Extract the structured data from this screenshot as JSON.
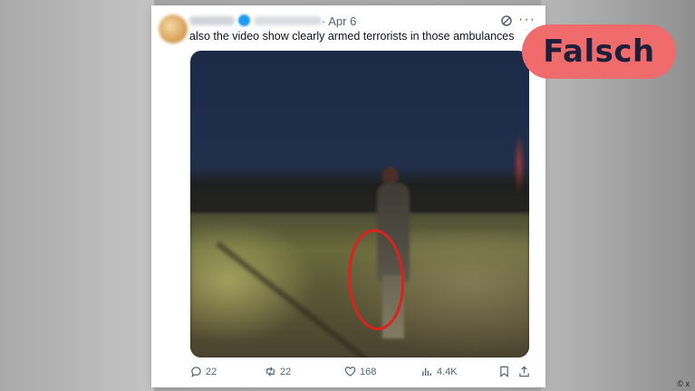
{
  "tweet": {
    "date": "· Apr 6",
    "text": "also the video show clearly armed terrorists in those ambulances",
    "actions": {
      "replies": "22",
      "reposts": "22",
      "likes": "168",
      "views": "4.4K"
    }
  },
  "overlay": {
    "verdict_label": "Falsch",
    "verdict_color": "#f06b6b"
  },
  "credit": "© x",
  "colors": {
    "highlight_circle": "#e0201c",
    "verified": "#1d9bf0"
  },
  "icons": [
    "reply-icon",
    "repost-icon",
    "like-icon",
    "views-icon",
    "bookmark-icon",
    "share-icon",
    "grok-icon",
    "more-icon"
  ]
}
